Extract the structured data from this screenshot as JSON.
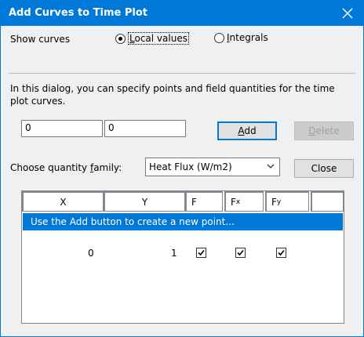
{
  "window": {
    "title": "Add Curves to Time Plot"
  },
  "show_curves": {
    "label": "Show curves",
    "options": [
      {
        "prefix": "",
        "accel": "L",
        "rest": "ocal values",
        "selected": true
      },
      {
        "prefix": "",
        "accel": "I",
        "rest": "ntegrals",
        "selected": false
      }
    ]
  },
  "description": "In this dialog, you can specify points and field quantities for the time plot curves.",
  "inputs": {
    "x_value": "0",
    "y_value": "0"
  },
  "buttons": {
    "add": {
      "accel": "A",
      "rest": "dd"
    },
    "delete": {
      "accel": "D",
      "rest": "elete"
    },
    "close": "Close"
  },
  "quantity_family": {
    "label_pre": "Choose quantity ",
    "label_accel": "f",
    "label_post": "amily:",
    "selected": "Heat Flux (W/m2)"
  },
  "table": {
    "headers": [
      "X",
      "Y",
      "F",
      "F",
      "F",
      ""
    ],
    "header_subscripts": [
      "",
      "",
      "",
      "x",
      "y",
      ""
    ],
    "hint": "Use the Add button to create a new point...",
    "rows": [
      {
        "x": "0",
        "y": "1",
        "f": true,
        "fx": true,
        "fy": true
      }
    ]
  }
}
